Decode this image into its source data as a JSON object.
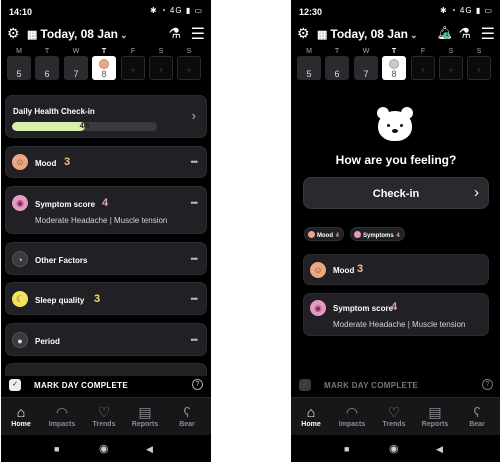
{
  "left": {
    "status": {
      "time": "14:10",
      "icons": "✱ ◔ 4G ▮ ▭"
    },
    "topbar": {
      "date": "Today, 08 Jan"
    },
    "week": [
      {
        "letter": "M",
        "num": "5"
      },
      {
        "letter": "T",
        "num": "6"
      },
      {
        "letter": "W",
        "num": "7"
      },
      {
        "letter": "T",
        "num": "8",
        "selected": true
      },
      {
        "letter": "F",
        "num": "+"
      },
      {
        "letter": "S",
        "num": "+"
      },
      {
        "letter": "S",
        "num": "+"
      }
    ],
    "checkin_card": {
      "title": "Daily Health Check-in",
      "progress_text": "4/8",
      "progress": 0.5
    },
    "cards": [
      {
        "title": "Mood",
        "value": "3"
      },
      {
        "title": "Symptom score",
        "value": "4",
        "sub": "Moderate Headache | Muscle tension"
      },
      {
        "title": "Other Factors"
      },
      {
        "title": "Sleep quality",
        "value": "3"
      },
      {
        "title": "Period"
      }
    ],
    "mark_day": "MARK DAY COMPLETE"
  },
  "right": {
    "status": {
      "time": "12:30",
      "icons": "✱ ◔ 4G ▮ ▭"
    },
    "topbar": {
      "date": "Today, 08 Jan",
      "notif_count": "1"
    },
    "week": [
      {
        "letter": "M",
        "num": "5"
      },
      {
        "letter": "T",
        "num": "6"
      },
      {
        "letter": "W",
        "num": "7"
      },
      {
        "letter": "T",
        "num": "8",
        "selected": true
      },
      {
        "letter": "F",
        "num": "+"
      },
      {
        "letter": "S",
        "num": "+"
      },
      {
        "letter": "S",
        "num": "+"
      }
    ],
    "question": "How are you feeling?",
    "checkin_button": "Check-in",
    "chips": [
      {
        "label": "Mood",
        "value": "4"
      },
      {
        "label": "Symptoms",
        "value": "4"
      }
    ],
    "cards": [
      {
        "title": "Mood",
        "value": "3"
      },
      {
        "title": "Symptom score",
        "value": "4",
        "sub": "Moderate Headache | Muscle tension"
      }
    ],
    "mark_day": "MARK DAY COMPLETE"
  },
  "tabs": [
    {
      "label": "Home",
      "icon": "home-icon"
    },
    {
      "label": "Impacts",
      "icon": "gauge-icon"
    },
    {
      "label": "Trends",
      "icon": "heart-icon"
    },
    {
      "label": "Reports",
      "icon": "book-icon"
    },
    {
      "label": "Bear",
      "icon": "bear-icon"
    }
  ],
  "colors": {
    "background": "#000000",
    "card": "#212024",
    "accent_progress": "#d8f0ac",
    "mood": "#e9a784",
    "symptom": "#e89bc2",
    "sleep": "#f3e35a",
    "value_mood": "#f2c08a",
    "value_symptom": "#e8a0b0",
    "value_sleep": "#f3e35a"
  }
}
